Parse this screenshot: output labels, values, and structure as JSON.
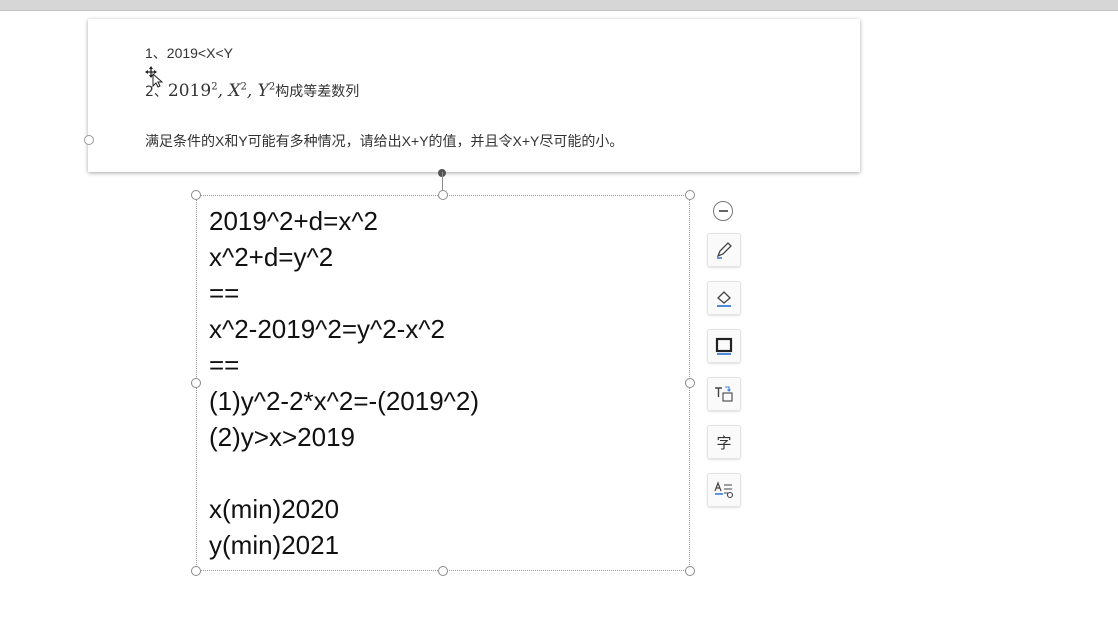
{
  "problem": {
    "line1": "1、2019<X<Y",
    "line2_prefix": "2、",
    "line2_base": "2019",
    "line2_sep1": ", X",
    "line2_sep2": ", Y",
    "line2_exp": "2",
    "line2_suffix": "构成等差数列",
    "line3": "满足条件的X和Y可能有多种情况，请给出X+Y的值，并且令X+Y尽可能的小。"
  },
  "textbox": {
    "lines": [
      "2019^2+d=x^2",
      "x^2+d=y^2",
      "==",
      "x^2-2019^2=y^2-x^2",
      "==",
      "(1)y^2-2*x^2=-(2019^2)",
      "(2)y>x>2019",
      "",
      "x(min)2020",
      "y(min)2021"
    ]
  },
  "toolbar": {
    "icons": [
      "collapse-icon",
      "pen-icon",
      "fill-icon",
      "border-icon",
      "text-box-icon",
      "font-icon",
      "text-style-icon"
    ],
    "font_label": "字"
  }
}
